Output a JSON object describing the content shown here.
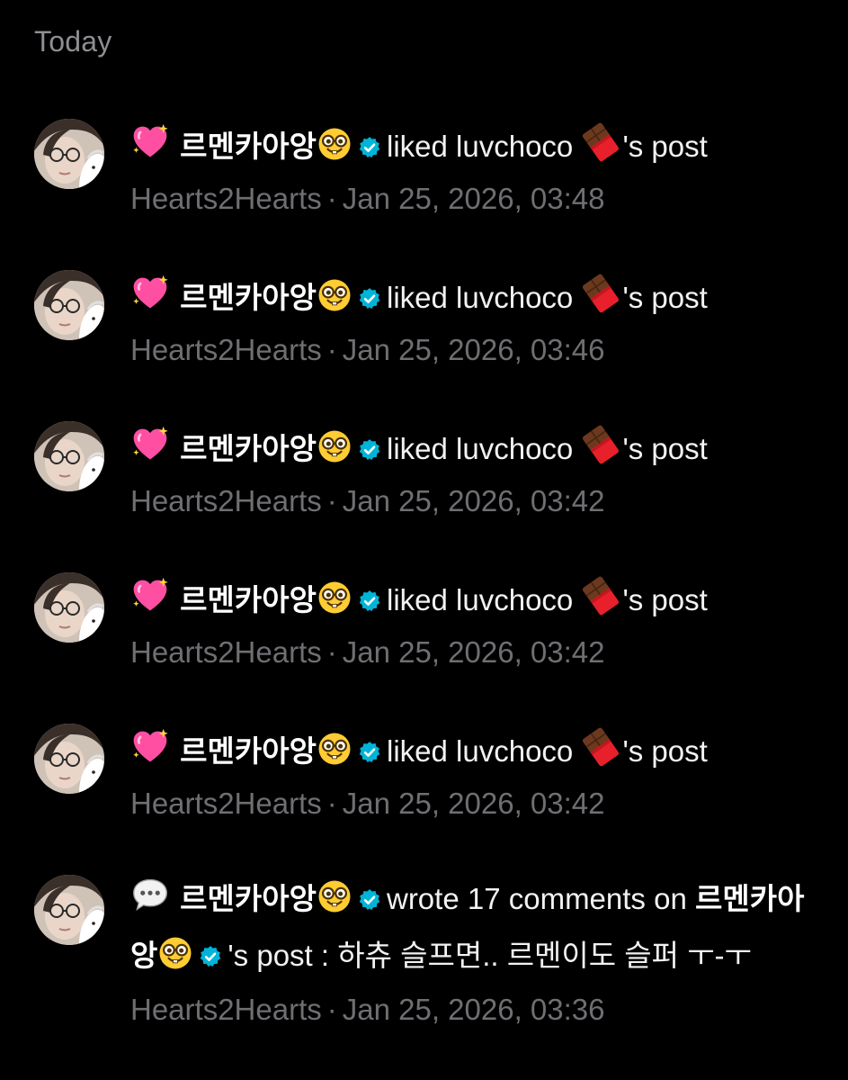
{
  "section_header": "Today",
  "notifications": [
    {
      "type": "like",
      "type_icon": "sparkling-heart-icon",
      "actor": "르멘카아앙",
      "actor_emoji": "nerd-face-icon",
      "verified": true,
      "action": "liked",
      "target": "luvchoco",
      "target_emoji": "chocolate-bar-icon",
      "suffix": "'s post",
      "community": "Hearts2Hearts",
      "separator": "·",
      "timestamp": "Jan 25, 2026, 03:48"
    },
    {
      "type": "like",
      "type_icon": "sparkling-heart-icon",
      "actor": "르멘카아앙",
      "actor_emoji": "nerd-face-icon",
      "verified": true,
      "action": "liked",
      "target": "luvchoco",
      "target_emoji": "chocolate-bar-icon",
      "suffix": "'s post",
      "community": "Hearts2Hearts",
      "separator": "·",
      "timestamp": "Jan 25, 2026, 03:46"
    },
    {
      "type": "like",
      "type_icon": "sparkling-heart-icon",
      "actor": "르멘카아앙",
      "actor_emoji": "nerd-face-icon",
      "verified": true,
      "action": "liked",
      "target": "luvchoco",
      "target_emoji": "chocolate-bar-icon",
      "suffix": "'s post",
      "community": "Hearts2Hearts",
      "separator": "·",
      "timestamp": "Jan 25, 2026, 03:42"
    },
    {
      "type": "like",
      "type_icon": "sparkling-heart-icon",
      "actor": "르멘카아앙",
      "actor_emoji": "nerd-face-icon",
      "verified": true,
      "action": "liked",
      "target": "luvchoco",
      "target_emoji": "chocolate-bar-icon",
      "suffix": "'s post",
      "community": "Hearts2Hearts",
      "separator": "·",
      "timestamp": "Jan 25, 2026, 03:42"
    },
    {
      "type": "like",
      "type_icon": "sparkling-heart-icon",
      "actor": "르멘카아앙",
      "actor_emoji": "nerd-face-icon",
      "verified": true,
      "action": "liked",
      "target": "luvchoco",
      "target_emoji": "chocolate-bar-icon",
      "suffix": "'s post",
      "community": "Hearts2Hearts",
      "separator": "·",
      "timestamp": "Jan 25, 2026, 03:42"
    }
  ],
  "comment_notification": {
    "type": "comment",
    "type_icon": "speech-bubble-icon",
    "actor": "르멘카아앙",
    "actor_emoji": "nerd-face-icon",
    "verified": true,
    "action": "wrote 17 comments on",
    "target": "르멘카아앙",
    "target_emoji": "nerd-face-icon",
    "target_verified": true,
    "suffix": "'s post : 하츄 슬프면.. 르멘이도 슬퍼 ㅜ-ㅜ",
    "community": "Hearts2Hearts",
    "separator": "·",
    "timestamp": "Jan 25, 2026, 03:36"
  },
  "colors": {
    "background": "#000000",
    "primary_text": "#ffffff",
    "secondary_text": "#6f6f73",
    "header_text": "#8e8e93",
    "verified_badge": "#00b4d8"
  }
}
